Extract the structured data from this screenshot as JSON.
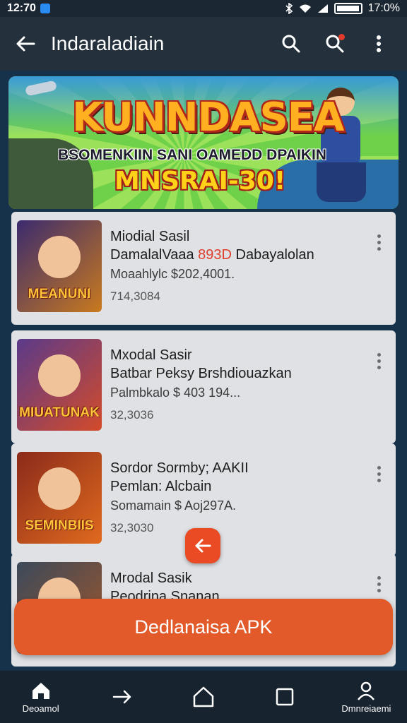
{
  "status_bar": {
    "time": "12:70",
    "battery": "17:0%"
  },
  "app_bar": {
    "title": "Indaraladiain"
  },
  "banner": {
    "title": "KUNNDASEA",
    "subtitle": "BSOMENKIIN SANI OAMEDD DPAIKIN",
    "promo": "MNSRAI-30!"
  },
  "apps": [
    {
      "title": "Miodial Sasil",
      "line2_a": "DamalalVaaa ",
      "line2_hl": "893D",
      "line2_b": " Dabayalolan",
      "line3": "Moaahlylc $202,4001.",
      "line4": "714,3084",
      "thumb_label": "MEANUNI",
      "thumb_bg": "#3a2a6e",
      "thumb_accent": "#c97a1e"
    },
    {
      "title": "Mxodal Sasir",
      "line2_a": "Batbar Peksy Brshdiouazkan",
      "line2_hl": "",
      "line2_b": "",
      "line3": "Palmbkalo $ 403 194...",
      "line4": "32,3036",
      "thumb_label": "MIUATUNAK",
      "thumb_bg": "#5a3a8a",
      "thumb_accent": "#d34b2a"
    },
    {
      "title": "Sordor Sormby; AAKII",
      "line2_a": "Pemlan: Alcbain",
      "line2_hl": "",
      "line2_b": "",
      "line3": "Somamain $ Aoj297A.",
      "line4": "32,3030",
      "thumb_label": "SEMINBIIS",
      "thumb_bg": "#8a2a1a",
      "thumb_accent": "#e06a1e"
    },
    {
      "title": "Mrodal Sasik",
      "line2_a": "Peodrina Snanan",
      "line2_hl": "",
      "line2_b": "",
      "line3": "",
      "line4": "",
      "thumb_label": "",
      "thumb_bg": "#3b4a5a",
      "thumb_accent": "#a3562a"
    }
  ],
  "download_button": "Dedlanaisa APK",
  "bottom_nav": {
    "home_label": "Deoamol",
    "profile_label": "Dmnreiaemi"
  },
  "colors": {
    "accent": "#e25a2a",
    "highlight": "#e0402b"
  },
  "icons": [
    "back-arrow-icon",
    "search-icon",
    "notification-search-icon",
    "more-vert-icon",
    "home-icon",
    "forward-arrow-icon",
    "house-icon",
    "square-icon",
    "profile-icon"
  ]
}
